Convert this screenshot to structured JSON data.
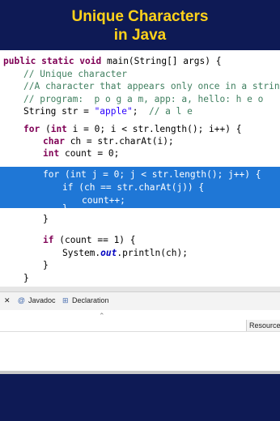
{
  "banner": {
    "line1": "Unique Characters",
    "line2": "in Java"
  },
  "code": {
    "signature": {
      "kw": "public static void",
      "rest": " main(String[] args) {"
    },
    "comment1": "// Unique character",
    "comment2": "//A character that appears only once in a string",
    "comment3": "// program:  p o g a m, app: a, hello: h e o",
    "strdecl_pre": "String str = ",
    "strdecl_val": "\"apple\"",
    "strdecl_post": ";",
    "strdecl_comment": "// a l e",
    "for_outer_kw": "for",
    "for_outer_int": "int",
    "for_outer_rest": " i = 0; i < str.length(); i++) {",
    "char_kw": "char",
    "char_rest": " ch = str.charAt(i);",
    "int_kw": "int",
    "int_rest": " count = 0;",
    "for_inner_kw": "for",
    "for_inner_int": "int",
    "for_inner_rest": " j = 0; j < str.length(); j++) {",
    "if_inner_kw": "if",
    "if_inner_rest": " (ch == str.charAt(j)) {",
    "count_inc": "count++;",
    "close_inner_if": "}",
    "close_inner_for": "}",
    "if_outer_kw": "if",
    "if_outer_rest": " (count == 1) {",
    "println_pre": "System.",
    "println_out": "out",
    "println_post": ".println(ch);",
    "close_if": "}",
    "close_for": "}"
  },
  "tabs": {
    "close": "✕",
    "javadoc": "Javadoc",
    "declaration": "Declaration",
    "javadoc_icon": "@",
    "declaration_icon": "⊞"
  },
  "panel": {
    "resource": "Resource",
    "caret": "⌃"
  }
}
